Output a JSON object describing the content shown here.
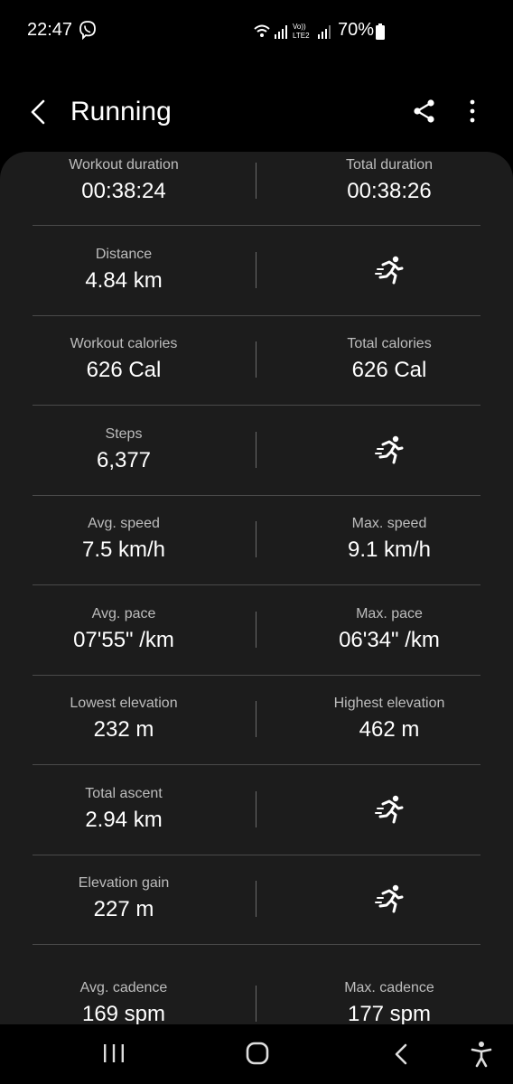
{
  "status_bar": {
    "time": "22:47",
    "battery": "70%",
    "network_label": "LTE2",
    "volte_label": "Vo))"
  },
  "header": {
    "title": "Running"
  },
  "stats": [
    {
      "left": {
        "label": "Workout duration",
        "value": "00:38:24"
      },
      "right": {
        "label": "Total duration",
        "value": "00:38:26"
      }
    },
    {
      "left": {
        "label": "Distance",
        "value": "4.84 km"
      },
      "right": {
        "icon": "running-icon"
      }
    },
    {
      "left": {
        "label": "Workout calories",
        "value": "626 Cal"
      },
      "right": {
        "label": "Total calories",
        "value": "626 Cal"
      }
    },
    {
      "left": {
        "label": "Steps",
        "value": "6,377"
      },
      "right": {
        "icon": "running-icon"
      }
    },
    {
      "left": {
        "label": "Avg. speed",
        "value": "7.5 km/h"
      },
      "right": {
        "label": "Max. speed",
        "value": "9.1 km/h"
      }
    },
    {
      "left": {
        "label": "Avg. pace",
        "value": "07'55\" /km"
      },
      "right": {
        "label": "Max. pace",
        "value": "06'34\" /km"
      }
    },
    {
      "left": {
        "label": "Lowest elevation",
        "value": "232 m"
      },
      "right": {
        "label": "Highest elevation",
        "value": "462 m"
      }
    },
    {
      "left": {
        "label": "Total ascent",
        "value": "2.94 km"
      },
      "right": {
        "icon": "running-icon"
      }
    },
    {
      "left": {
        "label": "Elevation gain",
        "value": "227 m"
      },
      "right": {
        "icon": "running-icon"
      }
    },
    {
      "left": {
        "label": "Avg. cadence",
        "value": "169 spm"
      },
      "right": {
        "label": "Max. cadence",
        "value": "177 spm"
      }
    }
  ],
  "icons": {
    "back": "back-arrow-icon",
    "share": "share-icon",
    "more": "more-vertical-icon",
    "nav_recents": "recents-icon",
    "nav_home": "home-icon",
    "nav_back": "nav-back-icon",
    "nav_accessibility": "accessibility-icon"
  }
}
